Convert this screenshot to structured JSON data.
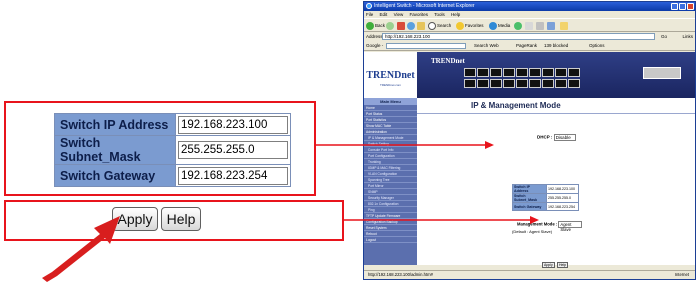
{
  "colors": {
    "callout_red": "#e8141c",
    "label_blue": "#7b9bd0",
    "ie_blue": "#0b3aa8",
    "sidebar_blue": "#5b6fae"
  },
  "zoom": {
    "fields": [
      {
        "label": "Switch IP Address",
        "value": "192.168.223.100"
      },
      {
        "label": "Switch Subnet_Mask",
        "value": "255.255.255.0"
      },
      {
        "label": "Switch Gateway",
        "value": "192.168.223.254"
      }
    ],
    "apply_label": "Apply",
    "help_label": "Help"
  },
  "browser": {
    "title": "Intelligent Switch - Microsoft Internet Explorer",
    "menu": [
      "File",
      "Edit",
      "View",
      "Favorites",
      "Tools",
      "Help"
    ],
    "toolbar": {
      "back": "Back",
      "search": "Search",
      "favorites": "Favorites",
      "media": "Media"
    },
    "address_label": "Address",
    "address": "http://192.168.223.100",
    "go": "Go",
    "links": "Links",
    "google_label": "Google -",
    "google_items": {
      "search_web": "Search Web",
      "pagerank": "PageRank",
      "blocked": "139 blocked",
      "options": "Options"
    },
    "status": "http://192.168.223.100/admin.htm#",
    "zone": "Internet"
  },
  "page": {
    "logo": "TRENDnet",
    "logo_sub": "TRENDnet.com",
    "brand": "TRENDnet",
    "sidebar_header": "Main Menu",
    "sidebar_items": [
      {
        "label": "Home",
        "sub": false
      },
      {
        "label": "Port Status",
        "sub": false
      },
      {
        "label": "Port Statistics",
        "sub": false
      },
      {
        "label": "Show MAC Table",
        "sub": false
      },
      {
        "label": "Administration",
        "sub": false
      },
      {
        "label": "IP & Management Mode",
        "sub": true
      },
      {
        "label": "Switch Setting",
        "sub": true
      },
      {
        "label": "Console Port Info",
        "sub": true
      },
      {
        "label": "Port Configuration",
        "sub": true
      },
      {
        "label": "Trunking",
        "sub": true
      },
      {
        "label": "IGMP & MAC Filtering",
        "sub": true
      },
      {
        "label": "VLAN Configuration",
        "sub": true
      },
      {
        "label": "Spanning Tree",
        "sub": true
      },
      {
        "label": "Port Mirror",
        "sub": true
      },
      {
        "label": "SNMP",
        "sub": true
      },
      {
        "label": "Security Manager",
        "sub": true
      },
      {
        "label": "802.1x Configuration",
        "sub": true
      },
      {
        "label": "Ping",
        "sub": true
      },
      {
        "label": "TFTP Update Firmware",
        "sub": false
      },
      {
        "label": "Configuration Backup",
        "sub": false
      },
      {
        "label": "Reset System",
        "sub": false
      },
      {
        "label": "Reboot",
        "sub": false
      },
      {
        "label": "Logout",
        "sub": false
      }
    ],
    "title": "IP & Management Mode",
    "dhcp_label": "DHCP :",
    "dhcp_value": "Disable",
    "fields": [
      {
        "label": "Switch IP Address",
        "value": "192.168.223.100"
      },
      {
        "label": "Switch Subnet_Mask",
        "value": "255.255.255.0"
      },
      {
        "label": "Switch Gateway",
        "value": "192.168.223.254"
      }
    ],
    "mgmt_label": "Management Mode :",
    "mgmt_value": "Agent Slave",
    "default_text": "(Default : Agent Slave)",
    "apply_label": "Apply",
    "help_label": "Help"
  }
}
